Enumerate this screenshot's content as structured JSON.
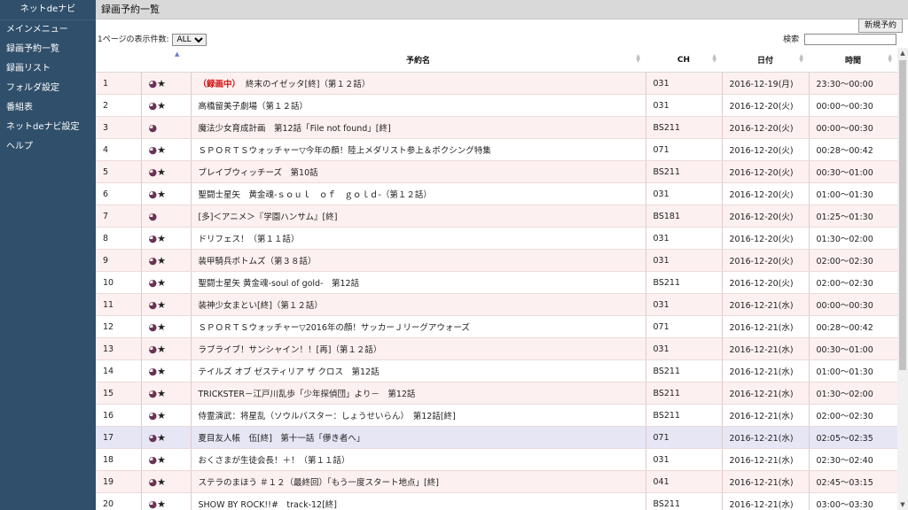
{
  "sidebar": {
    "brand": "ネットdeナビ",
    "items": [
      {
        "label": "メインメニュー"
      },
      {
        "label": "録画予約一覧"
      },
      {
        "label": "録画リスト"
      },
      {
        "label": "フォルダ設定"
      },
      {
        "label": "番組表"
      },
      {
        "label": "ネットdeナビ設定"
      },
      {
        "label": "ヘルプ"
      }
    ]
  },
  "header": {
    "title": "録画予約一覧"
  },
  "toolbar": {
    "new_label": "新規予約",
    "per_page_label": "1ページの表示件数:",
    "per_page_value": "ALL",
    "search_label": "検索",
    "search_value": ""
  },
  "table": {
    "columns": [
      "予約名",
      "CH",
      "日付",
      "時間"
    ],
    "rows": [
      {
        "no": "1",
        "star": "★",
        "recording": "（録画中）",
        "name": "終末のイゼッタ[終]（第１２話）",
        "ch": "031",
        "date": "2016-12-19(月)",
        "time": "23:30～00:00"
      },
      {
        "no": "2",
        "star": "★",
        "name": "高橋留美子劇場（第１２話）",
        "ch": "031",
        "date": "2016-12-20(火)",
        "time": "00:00～00:30"
      },
      {
        "no": "3",
        "star": "",
        "name": "魔法少女育成計画　第12話「File not found」[終]",
        "ch": "BS211",
        "date": "2016-12-20(火)",
        "time": "00:00～00:30"
      },
      {
        "no": "4",
        "star": "★",
        "name": "ＳＰＯＲＴＳウォッチャー▽今年の顔！陸上メダリスト参上＆ボクシング特集",
        "ch": "071",
        "date": "2016-12-20(火)",
        "time": "00:28～00:42"
      },
      {
        "no": "5",
        "star": "★",
        "name": "ブレイブウィッチーズ　第10話",
        "ch": "BS211",
        "date": "2016-12-20(火)",
        "time": "00:30～01:00"
      },
      {
        "no": "6",
        "star": "★",
        "name": "聖闘士星矢　黄金魂-ｓｏｕｌ　ｏｆ　ｇｏｌｄ-（第１２話）",
        "ch": "031",
        "date": "2016-12-20(火)",
        "time": "01:00～01:30"
      },
      {
        "no": "7",
        "star": "",
        "name": "[多]＜アニメ＞『学園ハンサム』[終]",
        "ch": "BS181",
        "date": "2016-12-20(火)",
        "time": "01:25～01:30"
      },
      {
        "no": "8",
        "star": "★",
        "name": "ドリフェス！（第１１話）",
        "ch": "031",
        "date": "2016-12-20(火)",
        "time": "01:30～02:00"
      },
      {
        "no": "9",
        "star": "★",
        "name": "装甲騎兵ボトムズ（第３８話）",
        "ch": "031",
        "date": "2016-12-20(火)",
        "time": "02:00～02:30"
      },
      {
        "no": "10",
        "star": "★",
        "name": "聖闘士星矢 黄金魂-soul of gold-　第12話",
        "ch": "BS211",
        "date": "2016-12-20(火)",
        "time": "02:00～02:30"
      },
      {
        "no": "11",
        "star": "★",
        "name": "装神少女まとい[終]（第１２話）",
        "ch": "031",
        "date": "2016-12-21(水)",
        "time": "00:00～00:30"
      },
      {
        "no": "12",
        "star": "★",
        "name": "ＳＰＯＲＴＳウォッチャー▽2016年の顔！サッカーＪリーグアウォーズ",
        "ch": "071",
        "date": "2016-12-21(水)",
        "time": "00:28～00:42"
      },
      {
        "no": "13",
        "star": "★",
        "name": "ラブライブ！サンシャイン！！[再]（第１２話）",
        "ch": "031",
        "date": "2016-12-21(水)",
        "time": "00:30～01:00"
      },
      {
        "no": "14",
        "star": "★",
        "name": "テイルズ オブ ゼスティリア ザ クロス　第12話",
        "ch": "BS211",
        "date": "2016-12-21(水)",
        "time": "01:00～01:30"
      },
      {
        "no": "15",
        "star": "★",
        "name": "TRICKSTER－江戸川乱歩「少年探偵団」より－　第12話",
        "ch": "BS211",
        "date": "2016-12-21(水)",
        "time": "01:30～02:00"
      },
      {
        "no": "16",
        "star": "★",
        "name": "侍霊演武：将星乱（ソウルバスター：しょうせいらん）　第12話[終]",
        "ch": "BS211",
        "date": "2016-12-21(水)",
        "time": "02:00～02:30"
      },
      {
        "no": "17",
        "star": "★",
        "name": "夏目友人帳　伍[終]　第十一話「儚き者へ」",
        "ch": "071",
        "date": "2016-12-21(水)",
        "time": "02:05～02:35"
      },
      {
        "no": "18",
        "star": "★",
        "name": "おくさまが生徒会長！＋！（第１１話）",
        "ch": "031",
        "date": "2016-12-21(水)",
        "time": "02:30～02:40"
      },
      {
        "no": "19",
        "star": "★",
        "name": "ステラのまほう ＃１２（最終回）「もう一度スタート地点」[終]",
        "ch": "041",
        "date": "2016-12-21(水)",
        "time": "02:45～03:15"
      },
      {
        "no": "20",
        "star": "★",
        "name": "SHOW BY ROCK!!#　track-12[終]",
        "ch": "BS211",
        "date": "2016-12-21(水)",
        "time": "03:00～03:30"
      }
    ]
  },
  "icons": {
    "clock": "clock-icon",
    "star": "star-icon"
  },
  "colors": {
    "sidebar_bg": "#2f4f6b",
    "odd_row": "#fdf0f0",
    "selected_row": "#e6e6f5",
    "recording_text": "#d01010"
  }
}
